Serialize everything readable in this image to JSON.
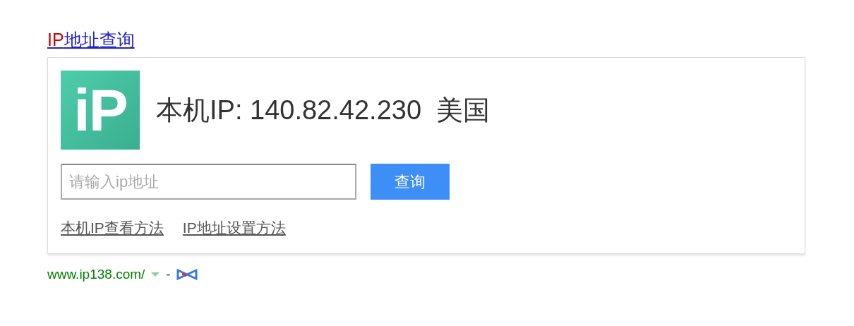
{
  "title": {
    "highlight": "IP",
    "rest": "地址查询"
  },
  "card": {
    "logo_text": "iP",
    "local_ip": "本机IP: 140.82.42.230  美国",
    "search": {
      "placeholder": "请输入ip地址"
    },
    "button": "查询",
    "links": [
      "本机IP查看方法",
      "IP地址设置方法"
    ]
  },
  "url": {
    "text": "www.ip138.com/",
    "separator": "-"
  }
}
